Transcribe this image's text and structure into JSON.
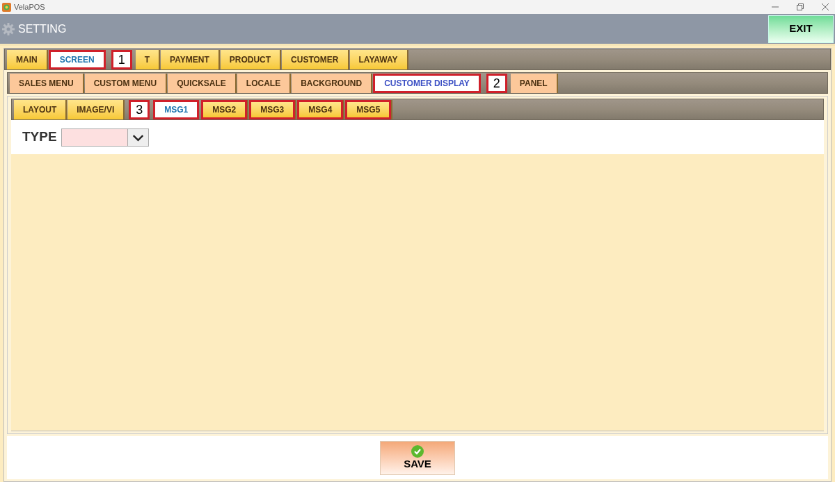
{
  "window": {
    "title": "VelaPOS"
  },
  "header": {
    "title": "SETTING",
    "exit_button": "EXIT"
  },
  "tab_rows": [
    {
      "items": [
        {
          "kind": "tab",
          "label": "MAIN",
          "selected": false,
          "framed": false
        },
        {
          "kind": "tab",
          "label": "SCREEN",
          "selected": true,
          "framed": true
        },
        {
          "kind": "callout",
          "label": "1"
        },
        {
          "kind": "tab",
          "label": "T",
          "selected": false,
          "framed": false
        },
        {
          "kind": "tab",
          "label": "PAYMENT",
          "selected": false,
          "framed": false
        },
        {
          "kind": "tab",
          "label": "PRODUCT",
          "selected": false,
          "framed": false
        },
        {
          "kind": "tab",
          "label": "CUSTOMER",
          "selected": false,
          "framed": false
        },
        {
          "kind": "tab",
          "label": "LAYAWAY",
          "selected": false,
          "framed": false
        }
      ]
    },
    {
      "items": [
        {
          "kind": "tab",
          "label": "SALES MENU",
          "selected": false,
          "framed": false
        },
        {
          "kind": "tab",
          "label": "CUSTOM MENU",
          "selected": false,
          "framed": false
        },
        {
          "kind": "tab",
          "label": "QUICKSALE",
          "selected": false,
          "framed": false
        },
        {
          "kind": "tab",
          "label": "LOCALE",
          "selected": false,
          "framed": false
        },
        {
          "kind": "tab",
          "label": "BACKGROUND",
          "selected": false,
          "framed": false
        },
        {
          "kind": "tab",
          "label": "CUSTOMER DISPLAY",
          "selected": true,
          "framed": true
        },
        {
          "kind": "callout",
          "label": "2"
        },
        {
          "kind": "tab",
          "label": "PANEL",
          "selected": false,
          "framed": false
        }
      ]
    },
    {
      "items": [
        {
          "kind": "tab",
          "label": "LAYOUT",
          "selected": false,
          "framed": false
        },
        {
          "kind": "tab",
          "label": "IMAGE/VI",
          "selected": false,
          "framed": false
        },
        {
          "kind": "callout",
          "label": "3"
        },
        {
          "kind": "tab",
          "label": "MSG1",
          "selected": true,
          "framed": true
        },
        {
          "kind": "tab",
          "label": "MSG2",
          "selected": false,
          "framed": true
        },
        {
          "kind": "tab",
          "label": "MSG3",
          "selected": false,
          "framed": true
        },
        {
          "kind": "tab",
          "label": "MSG4",
          "selected": false,
          "framed": true
        },
        {
          "kind": "tab",
          "label": "MSG5",
          "selected": false,
          "framed": true
        }
      ]
    }
  ],
  "type_field": {
    "label": "TYPE"
  },
  "save_button": "SAVE"
}
